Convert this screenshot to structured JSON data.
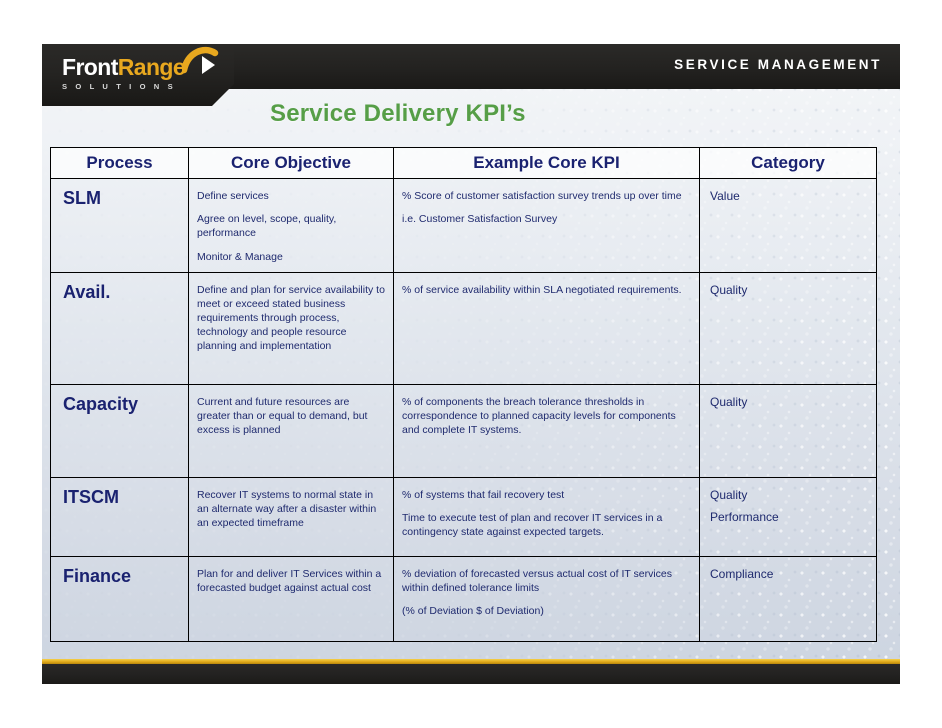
{
  "header": {
    "logo_front": "Front",
    "logo_range": "Range",
    "logo_sub": "S O L U T I O N S",
    "logo_swoosh_icon": "chevron-swoosh-icon",
    "brand_line": "SERVICE MANAGEMENT"
  },
  "title": "Service Delivery KPI’s",
  "table": {
    "columns": [
      "Process",
      "Core Objective",
      "Example Core KPI",
      "Category"
    ],
    "rows": [
      {
        "process": "SLM",
        "objective": [
          "Define services",
          "Agree on level, scope,  quality, performance",
          "Monitor & Manage"
        ],
        "kpi": [
          "% Score of customer satisfaction survey trends up over time",
          "i.e. Customer Satisfaction Survey"
        ],
        "category": [
          "Value"
        ]
      },
      {
        "process": "Avail.",
        "objective": [
          "Define and plan for service availability to meet or exceed stated business requirements through process, technology and people resource planning and implementation"
        ],
        "kpi": [
          "% of service availability within SLA negotiated requirements."
        ],
        "category": [
          "Quality"
        ]
      },
      {
        "process": "Capacity",
        "objective": [
          "Current and future resources are greater than or equal to demand, but excess is planned"
        ],
        "kpi": [
          "% of components the breach tolerance thresholds in correspondence to planned capacity levels for components and complete IT systems."
        ],
        "category": [
          "Quality"
        ]
      },
      {
        "process": "ITSCM",
        "objective": [
          "Recover IT systems to normal state in an alternate way after a disaster within an expected timeframe"
        ],
        "kpi": [
          "% of systems that fail recovery test",
          "Time to execute test of plan and recover IT services in a contingency state against expected targets."
        ],
        "category": [
          "Quality",
          "Performance"
        ]
      },
      {
        "process": "Finance",
        "objective": [
          "Plan for and deliver IT Services within a forecasted budget against actual cost"
        ],
        "kpi": [
          "% deviation of forecasted versus actual cost of IT services within defined tolerance limits",
          "(% of Deviation $ of Deviation)"
        ],
        "category": [
          "Compliance"
        ]
      }
    ]
  },
  "colors": {
    "title_green": "#569e47",
    "table_text_navy": "#1a2270",
    "logo_gold": "#e8a81f",
    "bar_dark": "#232220",
    "gold_rule": "#e0a91b"
  }
}
